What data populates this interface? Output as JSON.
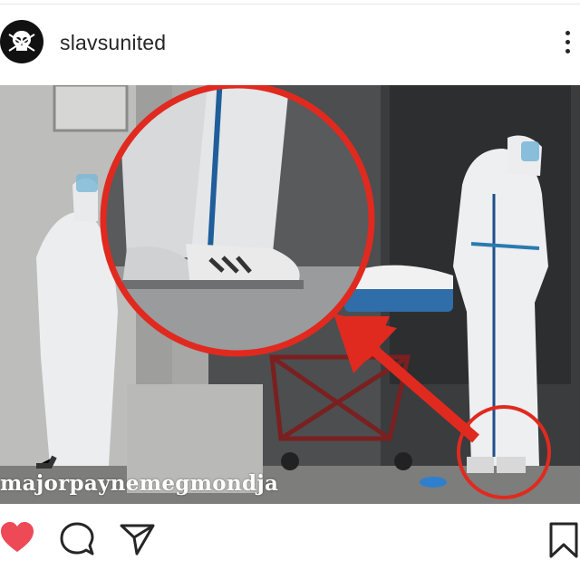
{
  "post": {
    "username": "slavsunited",
    "watermark": "majorpaynemegmondja",
    "avatar_icon": "skull-logo-icon",
    "accent_red": "#e02a1f",
    "like_color": "#ed4956"
  },
  "actions": {
    "like_icon": "heart-icon",
    "comment_icon": "comment-icon",
    "share_icon": "share-icon",
    "save_icon": "bookmark-icon"
  }
}
